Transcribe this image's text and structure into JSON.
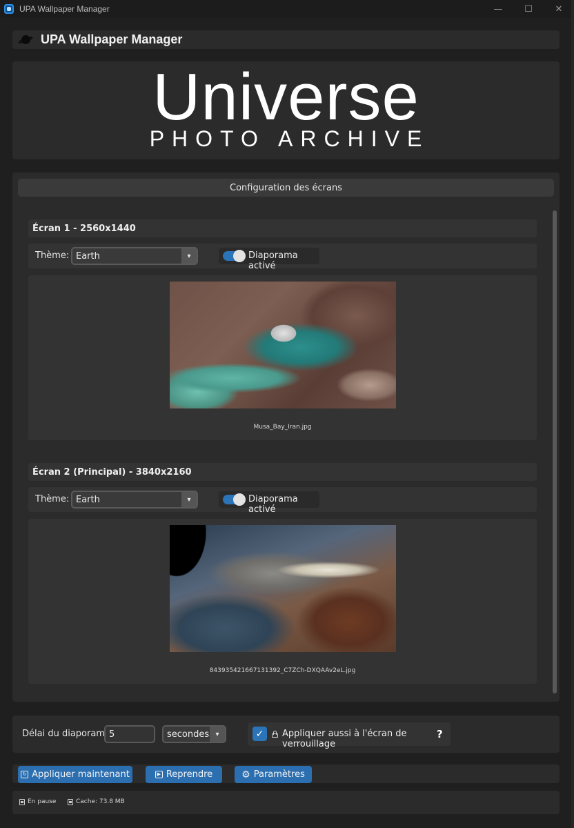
{
  "window": {
    "title": "UPA Wallpaper Manager",
    "controls": {
      "minimize": "—",
      "maximize": "☐",
      "close": "✕"
    }
  },
  "header": {
    "title": "UPA Wallpaper Manager",
    "icon": "planet-icon"
  },
  "logo": {
    "main": "Universe",
    "sub": "PHOTO ARCHIVE"
  },
  "config": {
    "title": "Configuration des écrans",
    "screens": [
      {
        "heading": "Écran 1 - 2560x1440",
        "theme_label": "Thème:",
        "theme_value": "Earth",
        "slideshow_label": "Diaporama activé",
        "slideshow_enabled": true,
        "filename": "Musa_Bay_Iran.jpg"
      },
      {
        "heading": "Écran 2 (Principal) - 3840x2160",
        "theme_label": "Thème:",
        "theme_value": "Earth",
        "slideshow_label": "Diaporama activé",
        "slideshow_enabled": true,
        "filename": "843935421667131392_C7ZCh-DXQAAv2eL.jpg"
      }
    ]
  },
  "delay": {
    "label": "Délai du diaporama:",
    "value": "5",
    "unit": "secondes",
    "lockscreen_label": "Appliquer aussi à l'écran de verrouillage",
    "lockscreen_checked": true,
    "help": "?"
  },
  "actions": {
    "apply": "Appliquer maintenant",
    "resume": "Reprendre",
    "settings": "Paramètres"
  },
  "status": {
    "state": "En pause",
    "cache": "Cache: 73.8 MB"
  },
  "colors": {
    "accent": "#2c74b8",
    "background": "#1f1f1f",
    "panel": "#2b2b2b"
  }
}
